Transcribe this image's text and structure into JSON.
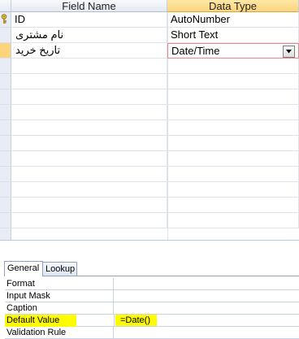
{
  "grid": {
    "headers": {
      "field_name": "Field Name",
      "data_type": "Data Type"
    },
    "rows": [
      {
        "field_name": "ID",
        "data_type": "AutoNumber",
        "is_key": true
      },
      {
        "field_name": "نام مشتری",
        "data_type": "Short Text"
      },
      {
        "field_name": "تاریخ خرید",
        "data_type": "Date/Time",
        "editing": true
      }
    ],
    "highlight_color": "#fbd47b"
  },
  "properties": {
    "tabs": [
      {
        "label": "General",
        "active": true
      },
      {
        "label": "Lookup",
        "active": false
      }
    ],
    "rows": [
      {
        "label": "Format",
        "value": ""
      },
      {
        "label": "Input Mask",
        "value": ""
      },
      {
        "label": "Caption",
        "value": ""
      },
      {
        "label": "Default Value",
        "value": "=Date()",
        "highlighted": true
      },
      {
        "label": "Validation Rule",
        "value": ""
      }
    ],
    "highlight_color": "#fffb00"
  },
  "icons": {
    "primary_key": "key-icon",
    "dropdown": "chevron-down-icon"
  }
}
